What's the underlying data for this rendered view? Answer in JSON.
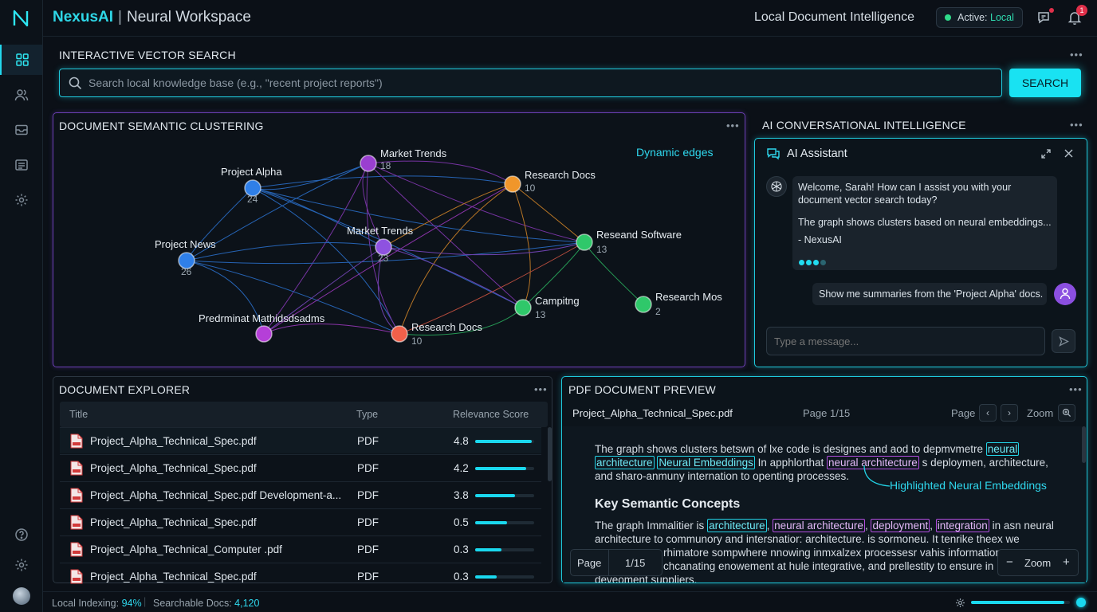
{
  "header": {
    "brand": "NexusAI",
    "workspace": "Neural Workspace",
    "title": "Local Document Intelligence",
    "status_label": "Active:",
    "status_value": "Local",
    "notification_count": "1"
  },
  "sidebar": {
    "items": [
      {
        "icon": "dashboard-icon",
        "active": true
      },
      {
        "icon": "users-icon",
        "active": false
      },
      {
        "icon": "mail-icon",
        "active": false
      },
      {
        "icon": "documents-icon",
        "active": false
      },
      {
        "icon": "gear-icon",
        "active": false
      }
    ],
    "bottom": [
      "help-icon",
      "settings-icon",
      "avatar"
    ]
  },
  "search": {
    "title": "INTERACTIVE VECTOR SEARCH",
    "placeholder": "Search local knowledge base (e.g., \"recent project reports\")",
    "button": "SEARCH"
  },
  "cluster": {
    "title": "DOCUMENT SEMANTIC CLUSTERING",
    "edge_note": "Dynamic edges",
    "nodes": [
      {
        "label": "Project Alpha",
        "count": "24",
        "color": "#2f7fe8"
      },
      {
        "label": "Market Trends",
        "count": "18",
        "color": "#9a3fd0"
      },
      {
        "label": "Research Docs",
        "count": "10",
        "color": "#f0962a"
      },
      {
        "label": "Project News",
        "count": "26",
        "color": "#2f7fe8"
      },
      {
        "label": "Market Trends",
        "count": "23",
        "color": "#8e52e0"
      },
      {
        "label": "Reseand Software",
        "count": "13",
        "color": "#2fc86a"
      },
      {
        "label": "Campitng",
        "count": "13",
        "color": "#2fc86a"
      },
      {
        "label": "Research Mos",
        "count": "2",
        "color": "#2fc86a"
      },
      {
        "label": "Predrminat Mathidsdsadms",
        "count": "",
        "color": "#b53fd8"
      },
      {
        "label": "Research Docs",
        "count": "10",
        "color": "#f0604a"
      }
    ]
  },
  "chat": {
    "section_title": "AI CONVERSATIONAL INTELLIGENCE",
    "title": "AI Assistant",
    "messages": [
      "Welcome, Sarah! How can I assist you with your document vector search today?",
      "The graph shows clusters based on neural embeddings...",
      "- NexusAI"
    ],
    "user_message": "Show me summaries from the 'Project Alpha' docs.",
    "input_placeholder": "Type a message..."
  },
  "explorer": {
    "title": "DOCUMENT EXPLORER",
    "columns": [
      "Title",
      "Type",
      "Relevance Score"
    ],
    "rows": [
      {
        "title": "Project_Alpha_Technical_Spec.pdf",
        "type": "PDF",
        "score": "4.8",
        "fill": 0.96
      },
      {
        "title": "Project_Alpha_Technical_Spec.pdf",
        "type": "PDF",
        "score": "4.2",
        "fill": 0.86
      },
      {
        "title": "Project_Alpha_Technical_Spec.pdf Development-a...",
        "type": "PDF",
        "score": "3.8",
        "fill": 0.68
      },
      {
        "title": "Project_Alpha_Technical_Spec.pdf",
        "type": "PDF",
        "score": "0.5",
        "fill": 0.54
      },
      {
        "title": "Project_Alpha_Technical_Computer .pdf",
        "type": "PDF",
        "score": "0.3",
        "fill": 0.44
      },
      {
        "title": "Project_Alpha_Technical_Spec.pdf",
        "type": "PDF",
        "score": "0.3",
        "fill": 0.36
      }
    ]
  },
  "pdf": {
    "title": "PDF DOCUMENT PREVIEW",
    "file": "Project_Alpha_Technical_Spec.pdf",
    "page_info": "Page 1/15",
    "page_label": "Page",
    "zoom_label": "Zoom",
    "para1_a": "The graph shows clusters betswn of lxe code is designes and aod to depmvmetre",
    "hl_neural": "neural",
    "hl_architecture": "architecture",
    "hl_neural_embeddings": "Neural Embeddings",
    "para1_b": "In apphlorthat",
    "hl_neural_architecture": "neural architecture",
    "para1_c": "s deploymen, architecture,",
    "para1_d": "and sharo-anmuny internation to openting processes.",
    "callout": "Highlighted Neural Embeddings",
    "heading": "Key Semantic Concepts",
    "para2_a": "The graph Immalitier is",
    "hl2_architecture": "architecture",
    "hl2_neural_architecture": "neural architecture",
    "hl2_deployment": "deployment",
    "hl2_integration": "integration",
    "para2_b": "in asn neural",
    "para2_c": "architecture to communory and intersnatior: architecture. is sormoneu. It tenrike theex we",
    "para2_d": "rhimatore sompwhere nnowing inmxalzex processesr vahis information c",
    "para2_e": "chcanating enowement at hule integrative, and prellestity to ensure in",
    "para2_f": "deveoment suppliers.",
    "float_page_label": "Page",
    "float_page_value": "1/15",
    "float_zoom_label": "Zoom"
  },
  "footer": {
    "indexing_label": "Local Indexing:",
    "indexing_value": "94%",
    "docs_label": "Searchable Docs:",
    "docs_value": "4,120",
    "progress": 0.94
  },
  "colors": {
    "accent": "#1fd8ee",
    "purple": "#9a4fe0",
    "background": "#0b1017"
  }
}
